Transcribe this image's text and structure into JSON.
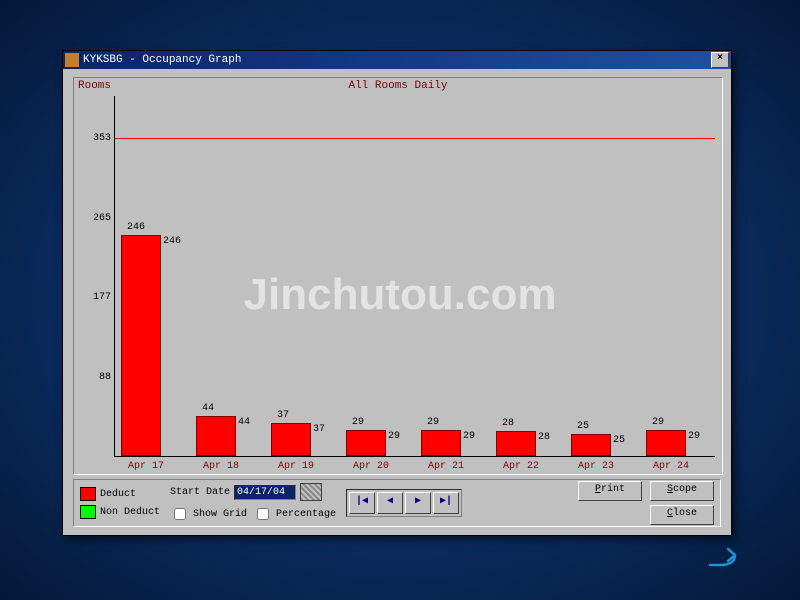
{
  "window": {
    "title": "KYKSBG - Occupancy Graph",
    "close_glyph": "×"
  },
  "chart_data": {
    "type": "bar",
    "title": "All Rooms Daily",
    "ylabel": "Rooms",
    "categories": [
      "Apr 17",
      "Apr 18",
      "Apr 19",
      "Apr 20",
      "Apr 21",
      "Apr 22",
      "Apr 23",
      "Apr 24"
    ],
    "series": [
      {
        "name": "Deduct",
        "values": [
          246,
          44,
          37,
          29,
          29,
          28,
          25,
          29
        ],
        "color": "#ff0000"
      },
      {
        "name": "Non Deduct",
        "values": [
          246,
          44,
          37,
          29,
          29,
          28,
          25,
          29
        ],
        "color": "#00ff00"
      }
    ],
    "yticks": [
      88,
      177,
      265,
      353
    ],
    "threshold": 353,
    "ylim": [
      0,
      400
    ]
  },
  "legend": {
    "deduct": "Deduct",
    "nondeduct": "Non Deduct"
  },
  "controls": {
    "start_date_label": "Start Date",
    "start_date_value": "04/17/04",
    "show_grid_label": "Show Grid",
    "percentage_label": "Percentage",
    "nav": {
      "first": "|◀",
      "prev": "◀",
      "next": "▶",
      "last": "▶|"
    }
  },
  "buttons": {
    "print": "Print",
    "scope": "Scope",
    "close": "Close"
  },
  "watermark": "Jinchutou.com"
}
